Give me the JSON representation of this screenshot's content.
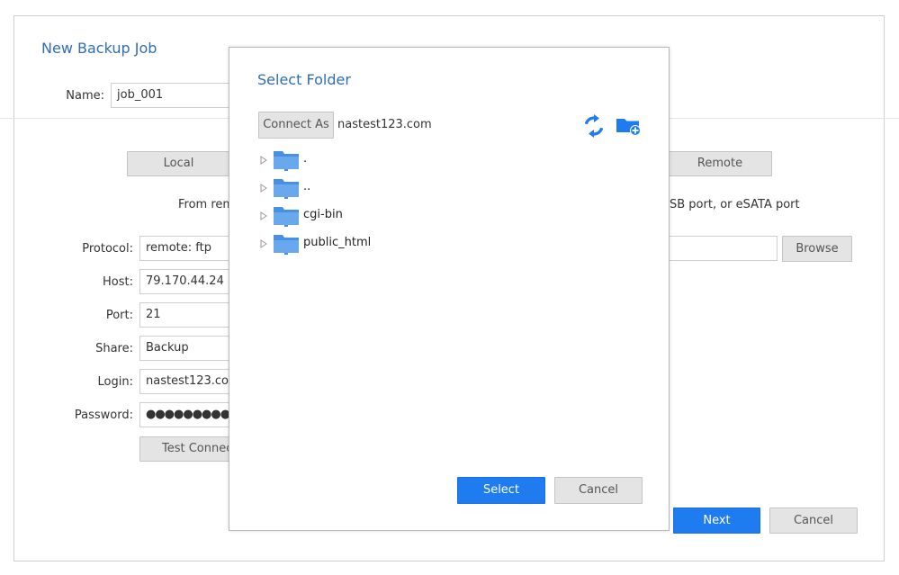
{
  "job": {
    "title": "New Backup Job",
    "name_label": "Name:",
    "name_value": "job_001",
    "local_label": "Local",
    "remote_label": "Remote",
    "desc_left": "From rem",
    "desc_right": "SB port, or eSATA port"
  },
  "form": {
    "protocol_label": "Protocol:",
    "protocol_value": "remote: ftp",
    "host_label": "Host:",
    "host_value": "79.170.44.24",
    "port_label": "Port:",
    "port_value": "21",
    "share_label": "Share:",
    "share_value": "Backup",
    "login_label": "Login:",
    "login_value": "nastest123.com",
    "password_label": "Password:",
    "password_value": "●●●●●●●●●",
    "test_label": "Test Connect",
    "browse_label": "Browse"
  },
  "footer": {
    "next_label": "Next",
    "cancel_label": "Cancel"
  },
  "dialog": {
    "title": "Select Folder",
    "connect_as_label": "Connect As",
    "host": "nastest123.com",
    "refresh_icon": "refresh-icon",
    "new_folder_icon": "new-folder-icon",
    "folders": [
      {
        "label": "."
      },
      {
        "label": ".."
      },
      {
        "label": "cgi-bin"
      },
      {
        "label": "public_html"
      }
    ],
    "select_label": "Select",
    "cancel_label": "Cancel"
  },
  "colors": {
    "accent": "#1f7cf0",
    "title": "#2f6db8",
    "folder": "#4a90e2"
  }
}
